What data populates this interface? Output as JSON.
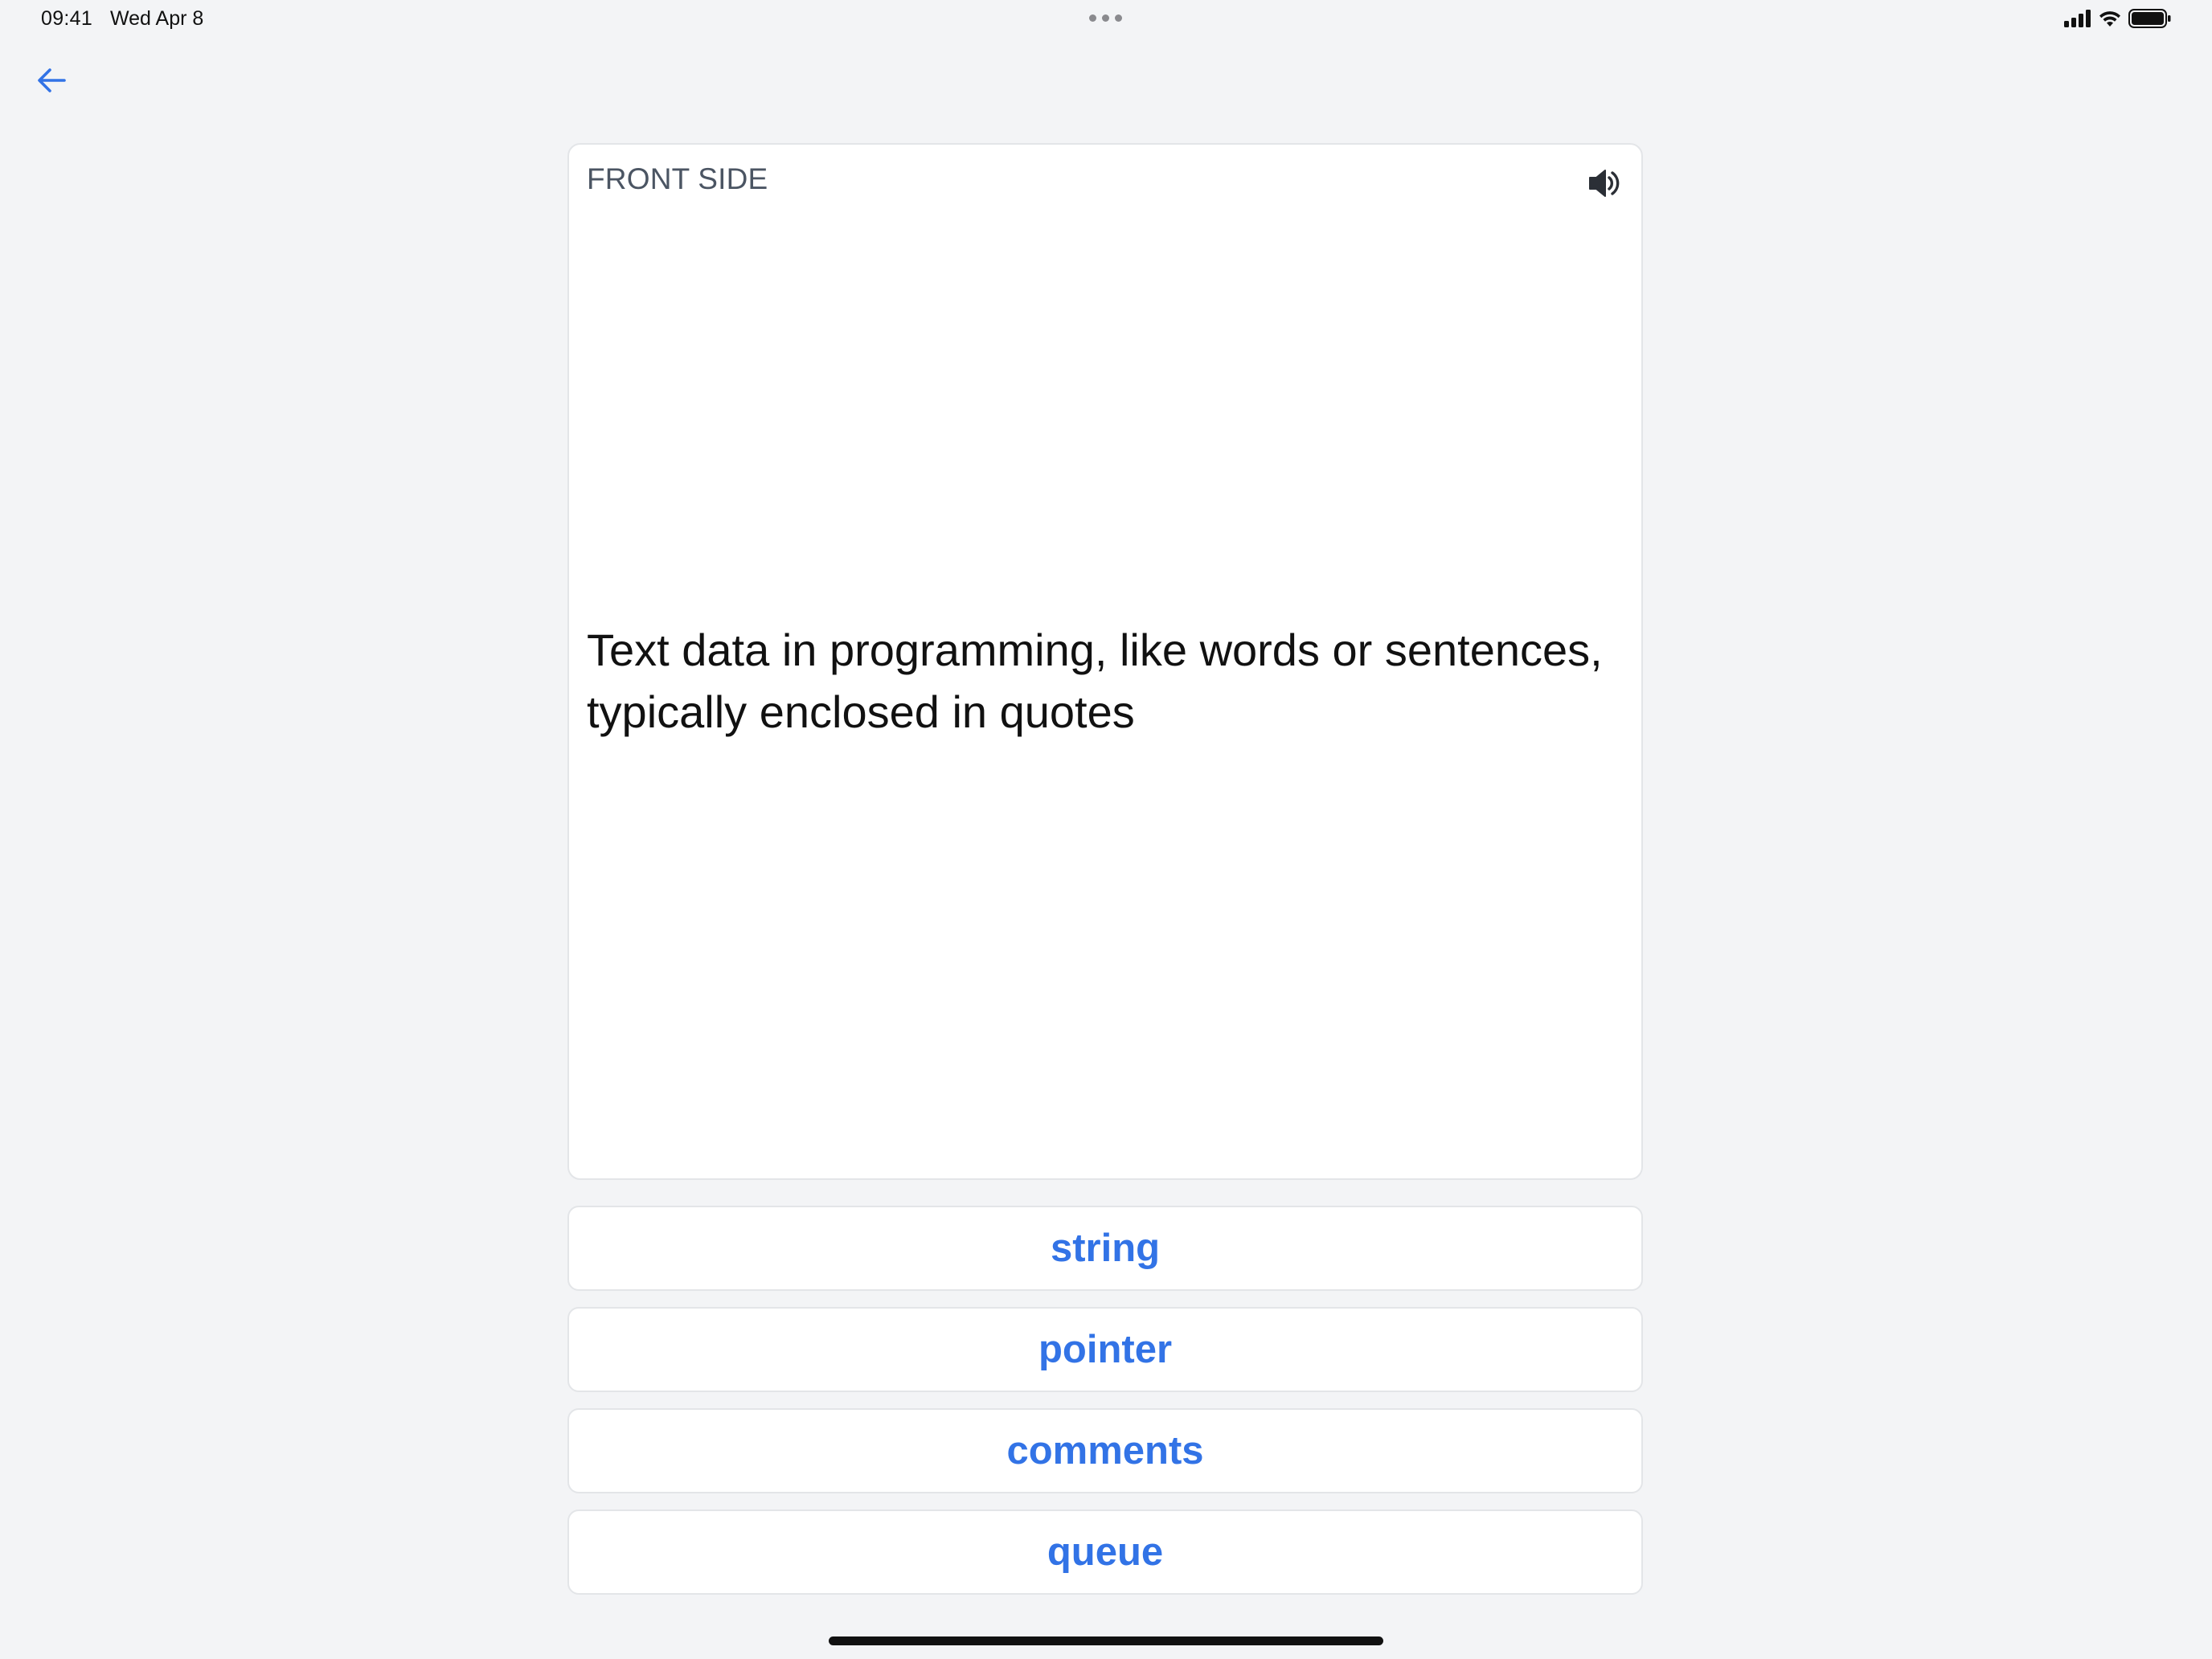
{
  "status_bar": {
    "time": "09:41",
    "date": "Wed Apr 8"
  },
  "card": {
    "label": "FRONT SIDE",
    "text": "Text data in programming, like words or sentences, typically enclosed in quotes"
  },
  "options": [
    {
      "label": "string"
    },
    {
      "label": "pointer"
    },
    {
      "label": "comments"
    },
    {
      "label": "queue"
    }
  ],
  "colors": {
    "accent": "#3273e6",
    "background": "#f3f4f6",
    "card": "#ffffff",
    "border": "#e3e5e8"
  },
  "icons": {
    "back": "arrow-left-icon",
    "speaker": "speaker-icon",
    "signal": "cellular-signal-icon",
    "wifi": "wifi-icon",
    "battery": "battery-icon"
  }
}
